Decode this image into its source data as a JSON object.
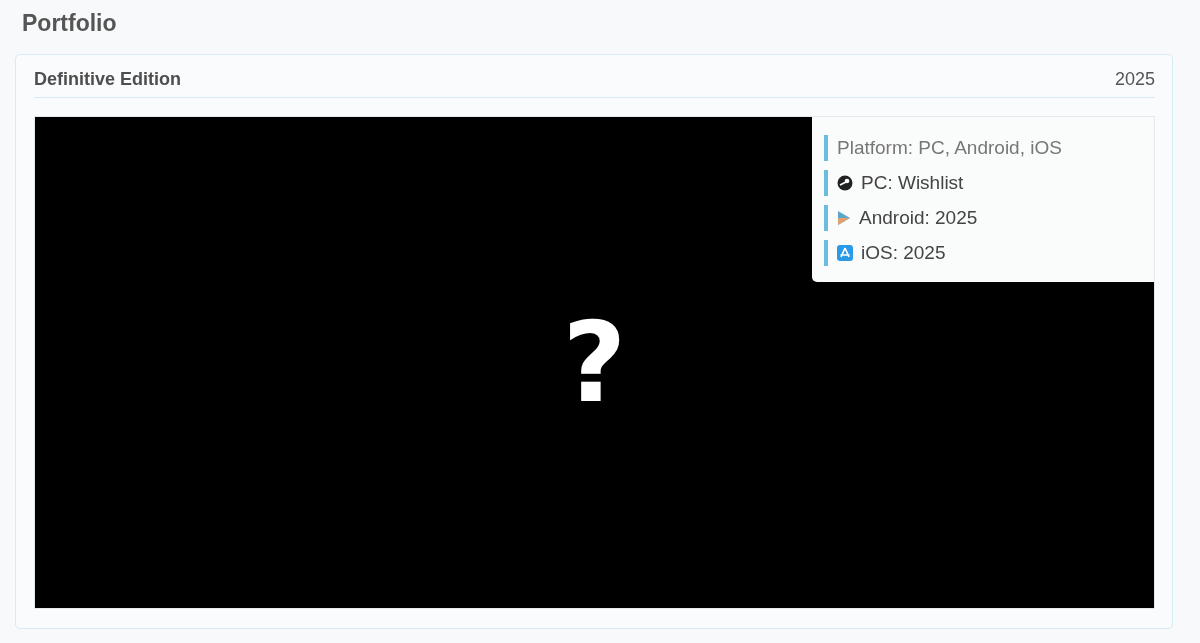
{
  "page": {
    "title": "Portfolio"
  },
  "card": {
    "title": "Definitive Edition",
    "year": "2025",
    "media": {
      "glyph": "?"
    },
    "info": [
      {
        "kind": "platforms",
        "text": "Platform: PC, Android, iOS"
      },
      {
        "kind": "pc",
        "text": "PC: Wishlist"
      },
      {
        "kind": "android",
        "text": "Android: 2025"
      },
      {
        "kind": "ios",
        "text": "iOS: 2025"
      }
    ]
  }
}
